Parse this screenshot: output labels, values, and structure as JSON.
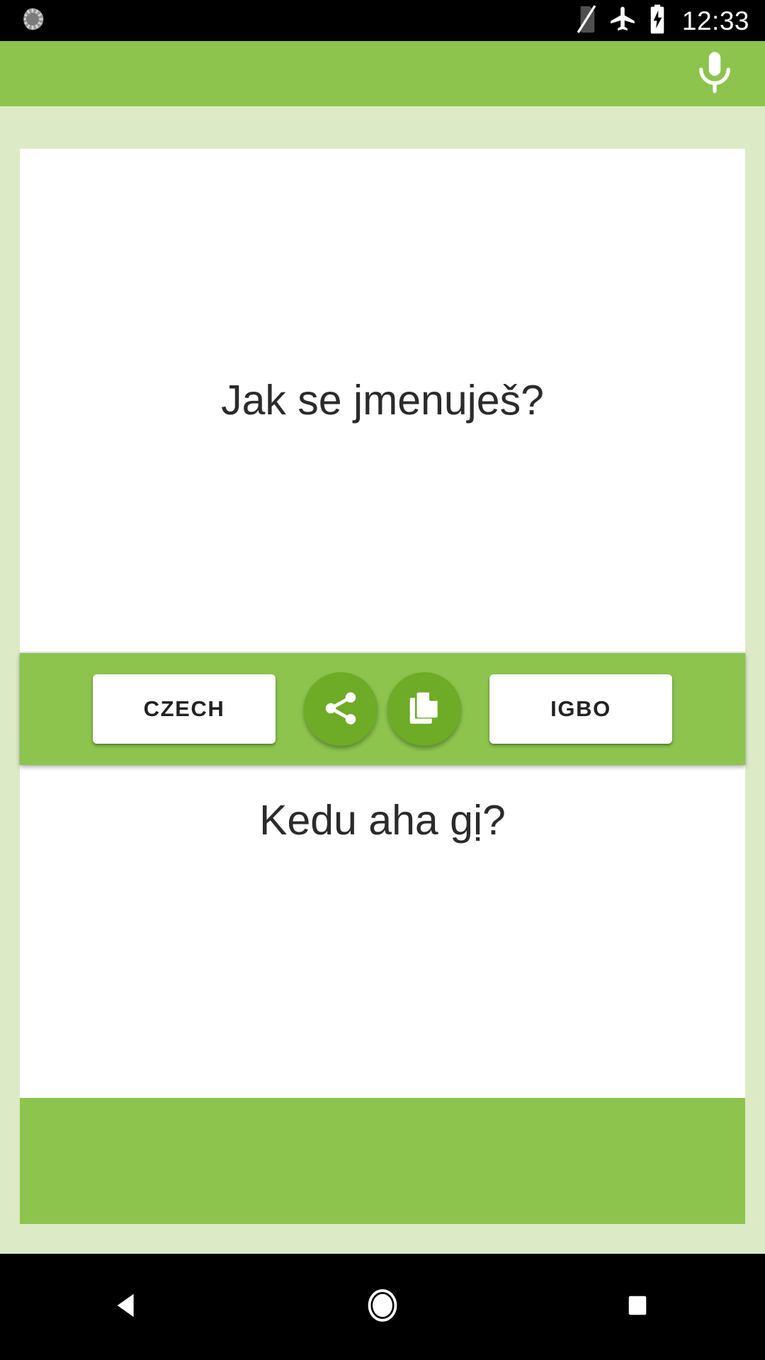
{
  "status_bar": {
    "notification_icon": "sync-circle-icon",
    "sim_icon": "no-sim-card-icon",
    "airplane_icon": "airplane-mode-icon",
    "battery_icon": "battery-charging-icon",
    "clock": "12:33"
  },
  "app_bar": {
    "mic_icon": "microphone-icon",
    "background_color": "#8cc44d"
  },
  "translator": {
    "source_text": "Jak se jmenuješ?",
    "target_text": "Kedu aha gị?",
    "source_language": "CZECH",
    "target_language": "IGBO",
    "share_icon": "share-icon",
    "copy_icon": "copy-icon",
    "accent_color": "#8cc44d",
    "button_circle_color": "#6eab27",
    "page_background_color": "#dceac6",
    "text_color": "#2b2b2b"
  },
  "nav_bar": {
    "back_icon": "back-triangle-icon",
    "home_icon": "home-circle-icon",
    "recents_icon": "recents-square-icon"
  }
}
